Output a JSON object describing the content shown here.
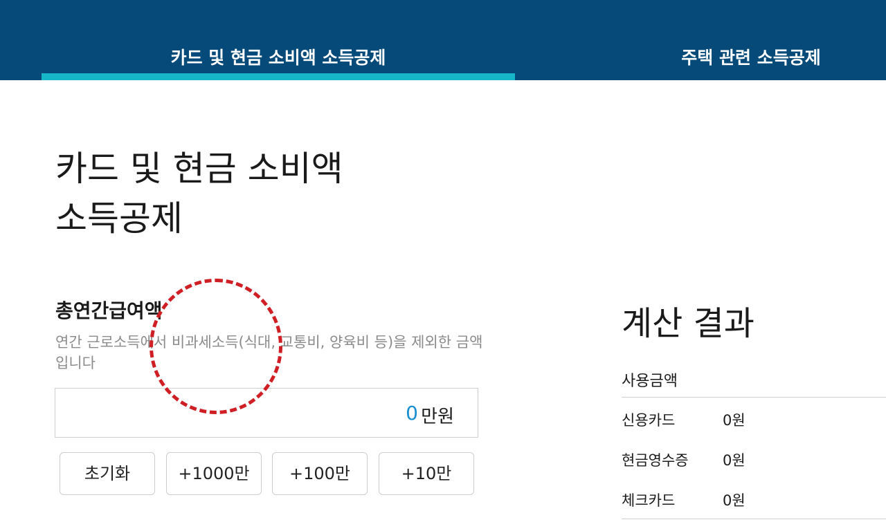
{
  "tabs": [
    {
      "label": "카드 및 현금 소비액 소득공제",
      "active": true
    },
    {
      "label": "주택 관련 소득공제",
      "active": false
    }
  ],
  "colors": {
    "header_bg": "#064a7a",
    "tab_indicator": "#16b6c8",
    "amount_value": "#1a8fd0",
    "annotation_circle": "#cf1e24"
  },
  "page": {
    "title": "카드 및 현금 소비액\n소득공제"
  },
  "salary": {
    "title": "총연간급여액",
    "description": "연간 근로소득에서 비과세소득(식대, 교통비, 양육비 등)을 제외한 금액입니다",
    "value": "0",
    "unit": "만원",
    "buttons": [
      "초기화",
      "+1000만",
      "+100만",
      "+10만"
    ]
  },
  "result": {
    "title": "계산 결과",
    "subtitle": "사용금액",
    "rows": [
      {
        "label": "신용카드",
        "value": "0원"
      },
      {
        "label": "현금영수증",
        "value": "0원"
      },
      {
        "label": "체크카드",
        "value": "0원"
      }
    ]
  }
}
